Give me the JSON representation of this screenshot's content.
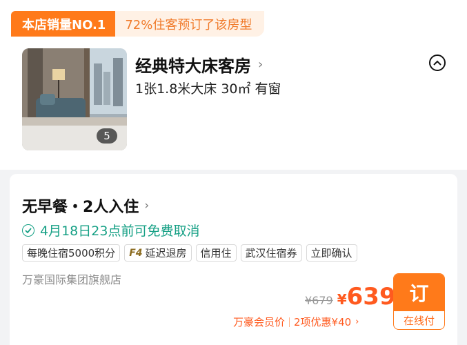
{
  "tags": {
    "primary": "本店销量NO.1",
    "secondary": "72%住客预订了该房型"
  },
  "room": {
    "title": "经典特大床客房",
    "specs": "1张1.8米大床  30㎡  有窗",
    "photo_count": "5"
  },
  "rate": {
    "meal_title": "无早餐・2人入住",
    "cancel_policy": "4月18日23点前可免费取消",
    "chips": [
      {
        "badge": "",
        "label": "每晚住宿5000积分"
      },
      {
        "badge": "F4",
        "label": "延迟退房"
      },
      {
        "badge": "",
        "label": "信用住"
      },
      {
        "badge": "",
        "label": "武汉住宿券"
      },
      {
        "badge": "",
        "label": "立即确认"
      }
    ],
    "shop_name": "万豪国际集团旗舰店",
    "original_price": "¥679",
    "currency": "¥",
    "price": "639",
    "member_label": "万豪会员价",
    "member_deal": "2项优惠¥40",
    "book_label": "订",
    "pay_label": "在线付"
  },
  "colors": {
    "accent_orange": "#ff7a1a",
    "price_orange": "#ff5a1f",
    "free_cancel_green": "#16a085"
  },
  "icons": {
    "collapse": "chevron-up-circle-icon",
    "cancel_check": "check-circle-icon",
    "title_chevron": "chevron-right-icon"
  }
}
